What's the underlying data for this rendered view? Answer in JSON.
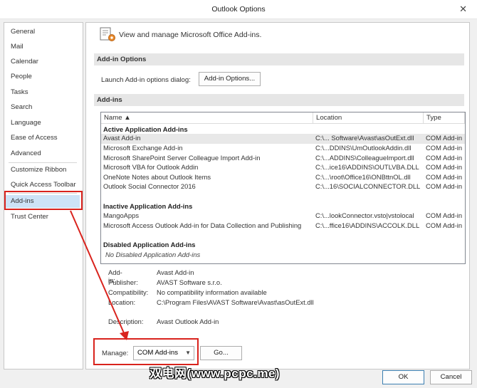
{
  "window": {
    "title": "Outlook Options",
    "close_glyph": "✕"
  },
  "nav": {
    "items": [
      {
        "label": "General"
      },
      {
        "label": "Mail"
      },
      {
        "label": "Calendar"
      },
      {
        "label": "People"
      },
      {
        "label": "Tasks"
      },
      {
        "label": "Search"
      },
      {
        "label": "Language"
      },
      {
        "label": "Ease of Access"
      },
      {
        "label": "Advanced"
      },
      {
        "label": "Customize Ribbon"
      },
      {
        "label": "Quick Access Toolbar"
      },
      {
        "label": "Add-ins"
      },
      {
        "label": "Trust Center"
      }
    ],
    "selected": "Add-ins"
  },
  "header": {
    "text": "View and manage Microsoft Office Add-ins.",
    "icon": "addins-gear-icon"
  },
  "addin_options": {
    "section_title": "Add-in Options",
    "launch_label": "Launch Add-in options dialog:",
    "button_label": "Add-in Options..."
  },
  "addins": {
    "section_title": "Add-ins",
    "columns": {
      "name": "Name ▲",
      "location": "Location",
      "type": "Type"
    },
    "groups": {
      "active": "Active Application Add-ins",
      "inactive": "Inactive Application Add-ins",
      "disabled": "Disabled Application Add-ins",
      "no_disabled": "No Disabled Application Add-ins"
    },
    "active_rows": [
      {
        "name": "Avast Add-in",
        "location": "C:\\... Software\\Avast\\asOutExt.dll",
        "type": "COM Add-in"
      },
      {
        "name": "Microsoft Exchange Add-in",
        "location": "C:\\...DDINS\\UmOutlookAddin.dll",
        "type": "COM Add-in"
      },
      {
        "name": "Microsoft SharePoint Server Colleague Import Add-in",
        "location": "C:\\...ADDINS\\ColleagueImport.dll",
        "type": "COM Add-in"
      },
      {
        "name": "Microsoft VBA for Outlook Addin",
        "location": "C:\\...ice16\\ADDINS\\OUTLVBA.DLL",
        "type": "COM Add-in"
      },
      {
        "name": "OneNote Notes about Outlook Items",
        "location": "C:\\...\\root\\Office16\\ONBttnOL.dll",
        "type": "COM Add-in"
      },
      {
        "name": "Outlook Social Connector 2016",
        "location": "C:\\...16\\SOCIALCONNECTOR.DLL",
        "type": "COM Add-in"
      }
    ],
    "inactive_rows": [
      {
        "name": "MangoApps",
        "location": "C:\\...lookConnector.vsto|vstolocal",
        "type": "COM Add-in"
      },
      {
        "name": "Microsoft Access Outlook Add-in for Data Collection and Publishing",
        "location": "C:\\...ffice16\\ADDINS\\ACCOLK.DLL",
        "type": "COM Add-in"
      }
    ]
  },
  "details": {
    "addin_label": "Add-in:",
    "addin_value": "Avast Add-in",
    "publisher_label": "Publisher:",
    "publisher_value": "AVAST Software s.r.o.",
    "compat_label": "Compatibility:",
    "compat_value": "No compatibility information available",
    "location_label": "Location:",
    "location_value": "C:\\Program Files\\AVAST Software\\Avast\\asOutExt.dll",
    "description_label": "Description:",
    "description_value": "Avast Outlook Add-in"
  },
  "manage": {
    "label": "Manage:",
    "selected": "COM Add-ins",
    "go_label": "Go..."
  },
  "footer": {
    "ok_label": "OK",
    "cancel_label": "Cancel"
  },
  "watermark": "双电网(www.pcpc.me)",
  "colors": {
    "highlight": "#d9231d",
    "selected_nav": "#cde3f7"
  }
}
